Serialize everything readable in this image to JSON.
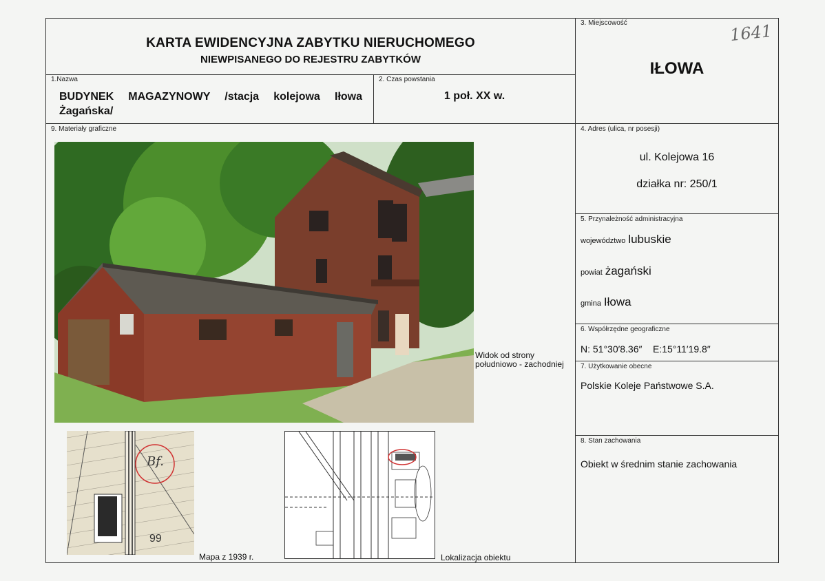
{
  "header": {
    "title_line1": "KARTA EWIDENCYJNA ZABYTKU NIERUCHOMEGO",
    "title_line2": "NIEWPISANEGO DO REJESTRU ZABYTKÓW"
  },
  "inventory_number": "1641",
  "fields": {
    "nazwa": {
      "label": "1.Nazwa",
      "value": "BUDYNEK MAGAZYNOWY /stacja kolejowa Iłowa Żagańska/"
    },
    "czas": {
      "label": "2. Czas powstania",
      "value": "1 poł. XX w."
    },
    "miejscowosc": {
      "label": "3. Miejscowość",
      "value": "IŁOWA"
    },
    "adres": {
      "label": "4. Adres (ulica, nr posesji)",
      "street": "ul. Kolejowa 16",
      "plot": "działka nr: 250/1"
    },
    "administracja": {
      "label": "5. Przynależność administracyjna",
      "wojewodztwo_label": "województwo",
      "wojewodztwo": "lubuskie",
      "powiat_label": "powiat",
      "powiat": "żagański",
      "gmina_label": "gmina",
      "gmina": "Iłowa"
    },
    "wspolrzedne": {
      "label": "6. Współrzędne geograficzne",
      "n": "N: 51°30′8.36″",
      "e": "E:15°11′19.8″"
    },
    "uzytkowanie": {
      "label": "7. Użytkowanie obecne",
      "value": "Polskie Koleje Państwowe S.A."
    },
    "stan": {
      "label": "8. Stan zachowania",
      "value": "Obiekt w średnim stanie zachowania"
    },
    "materialy": {
      "label": "9. Materiały graficzne"
    }
  },
  "graphics": {
    "photo_caption_line1": "Widok od strony",
    "photo_caption_line2": "południowo - zachodniej",
    "map1_caption": "Mapa z 1939 r.",
    "map2_caption": "Lokalizacja obiektu",
    "map1_mark": "Bf.",
    "map1_number": "99"
  }
}
